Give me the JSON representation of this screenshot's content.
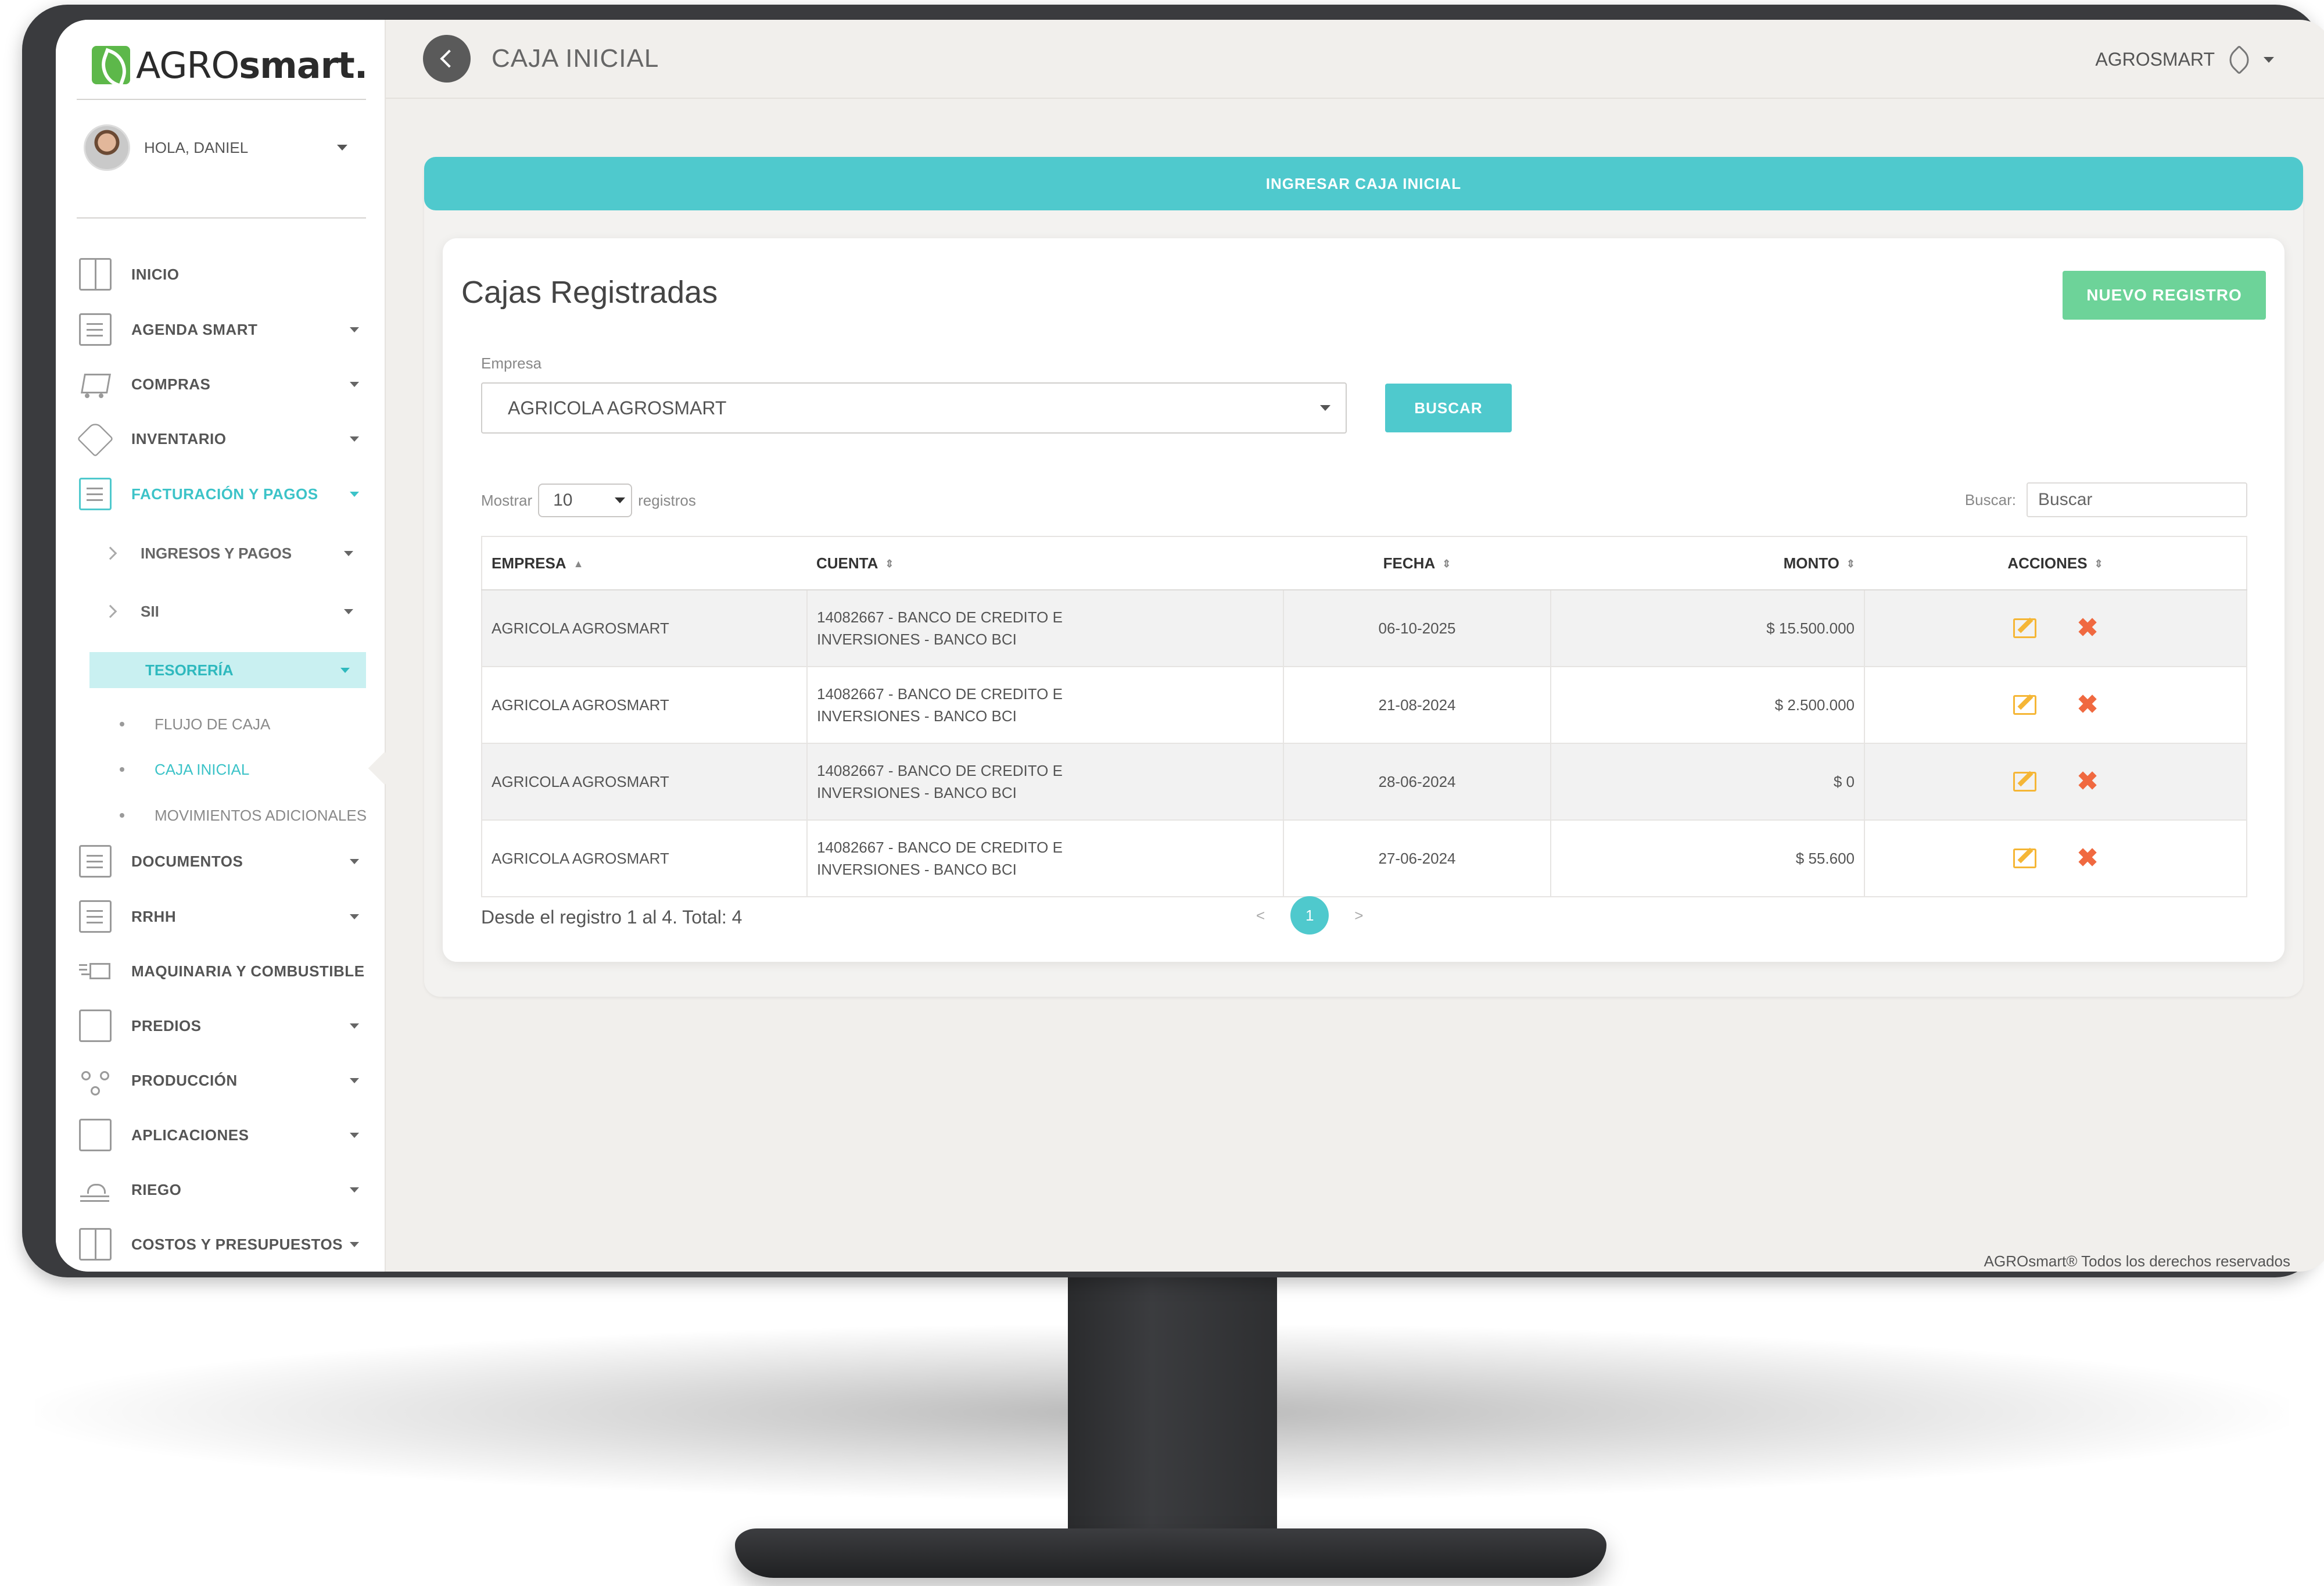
{
  "brand": {
    "logo_light": "AGRO",
    "logo_bold": "smart."
  },
  "user": {
    "greeting": "HOLA, DANIEL"
  },
  "sidebar": {
    "items": [
      {
        "label": "INICIO",
        "icon": "grid-icon"
      },
      {
        "label": "AGENDA SMART",
        "icon": "agenda-icon"
      },
      {
        "label": "COMPRAS",
        "icon": "cart-icon"
      },
      {
        "label": "INVENTARIO",
        "icon": "tag-icon"
      },
      {
        "label": "FACTURACIÓN Y PAGOS",
        "icon": "invoice-icon"
      },
      {
        "label": "DOCUMENTOS",
        "icon": "document-icon"
      },
      {
        "label": "RRHH",
        "icon": "id-card-icon"
      },
      {
        "label": "MAQUINARIA Y COMBUSTIBLE",
        "icon": "truck-icon"
      },
      {
        "label": "PREDIOS",
        "icon": "map-icon"
      },
      {
        "label": "PRODUCCIÓN",
        "icon": "network-icon"
      },
      {
        "label": "APLICACIONES",
        "icon": "calendar-icon"
      },
      {
        "label": "RIEGO",
        "icon": "sunrise-icon"
      },
      {
        "label": "COSTOS Y PRESUPUESTOS",
        "icon": "ruler-icon"
      }
    ],
    "sub_items": [
      {
        "label": "INGRESOS Y PAGOS"
      },
      {
        "label": "SII"
      },
      {
        "label": "TESORERÍA"
      }
    ],
    "leaf_items": [
      {
        "label": "FLUJO DE CAJA"
      },
      {
        "label": "CAJA INICIAL"
      },
      {
        "label": "MOVIMIENTOS ADICIONALES"
      }
    ]
  },
  "header": {
    "title": "CAJA INICIAL",
    "account": "AGROSMART"
  },
  "banner": {
    "label": "INGRESAR CAJA INICIAL"
  },
  "main": {
    "title": "Cajas Registradas",
    "new_button": "NUEVO REGISTRO",
    "empresa_label": "Empresa",
    "empresa_value": "AGRICOLA AGROSMART",
    "search_button": "BUSCAR",
    "show_label": "Mostrar",
    "show_value": "10",
    "records_label": "registros",
    "search_label": "Buscar:",
    "search_placeholder": "Buscar"
  },
  "table": {
    "columns": [
      "EMPRESA",
      "CUENTA",
      "FECHA",
      "MONTO",
      "ACCIONES"
    ],
    "rows": [
      {
        "empresa": "AGRICOLA AGROSMART",
        "cuenta_1": "14082667 - BANCO DE CREDITO E",
        "cuenta_2": "INVERSIONES - BANCO BCI",
        "fecha": "06-10-2025",
        "monto": "$ 15.500.000"
      },
      {
        "empresa": "AGRICOLA AGROSMART",
        "cuenta_1": "14082667 - BANCO DE CREDITO E",
        "cuenta_2": "INVERSIONES - BANCO BCI",
        "fecha": "21-08-2024",
        "monto": "$ 2.500.000"
      },
      {
        "empresa": "AGRICOLA AGROSMART",
        "cuenta_1": "14082667 - BANCO DE CREDITO E",
        "cuenta_2": "INVERSIONES - BANCO BCI",
        "fecha": "28-06-2024",
        "monto": "$ 0"
      },
      {
        "empresa": "AGRICOLA AGROSMART",
        "cuenta_1": "14082667 - BANCO DE CREDITO E",
        "cuenta_2": "INVERSIONES - BANCO BCI",
        "fecha": "27-06-2024",
        "monto": "$ 55.600"
      }
    ]
  },
  "pagination": {
    "summary": "Desde el registro 1 al 4. Total: 4",
    "prev": "<",
    "current": "1",
    "next": ">"
  },
  "footer": {
    "copyright": "AGROsmart® Todos los derechos reservados"
  },
  "colors": {
    "accent": "#4fc9cd",
    "success": "#6dd399",
    "edit": "#f5b636",
    "delete": "#f06940"
  }
}
